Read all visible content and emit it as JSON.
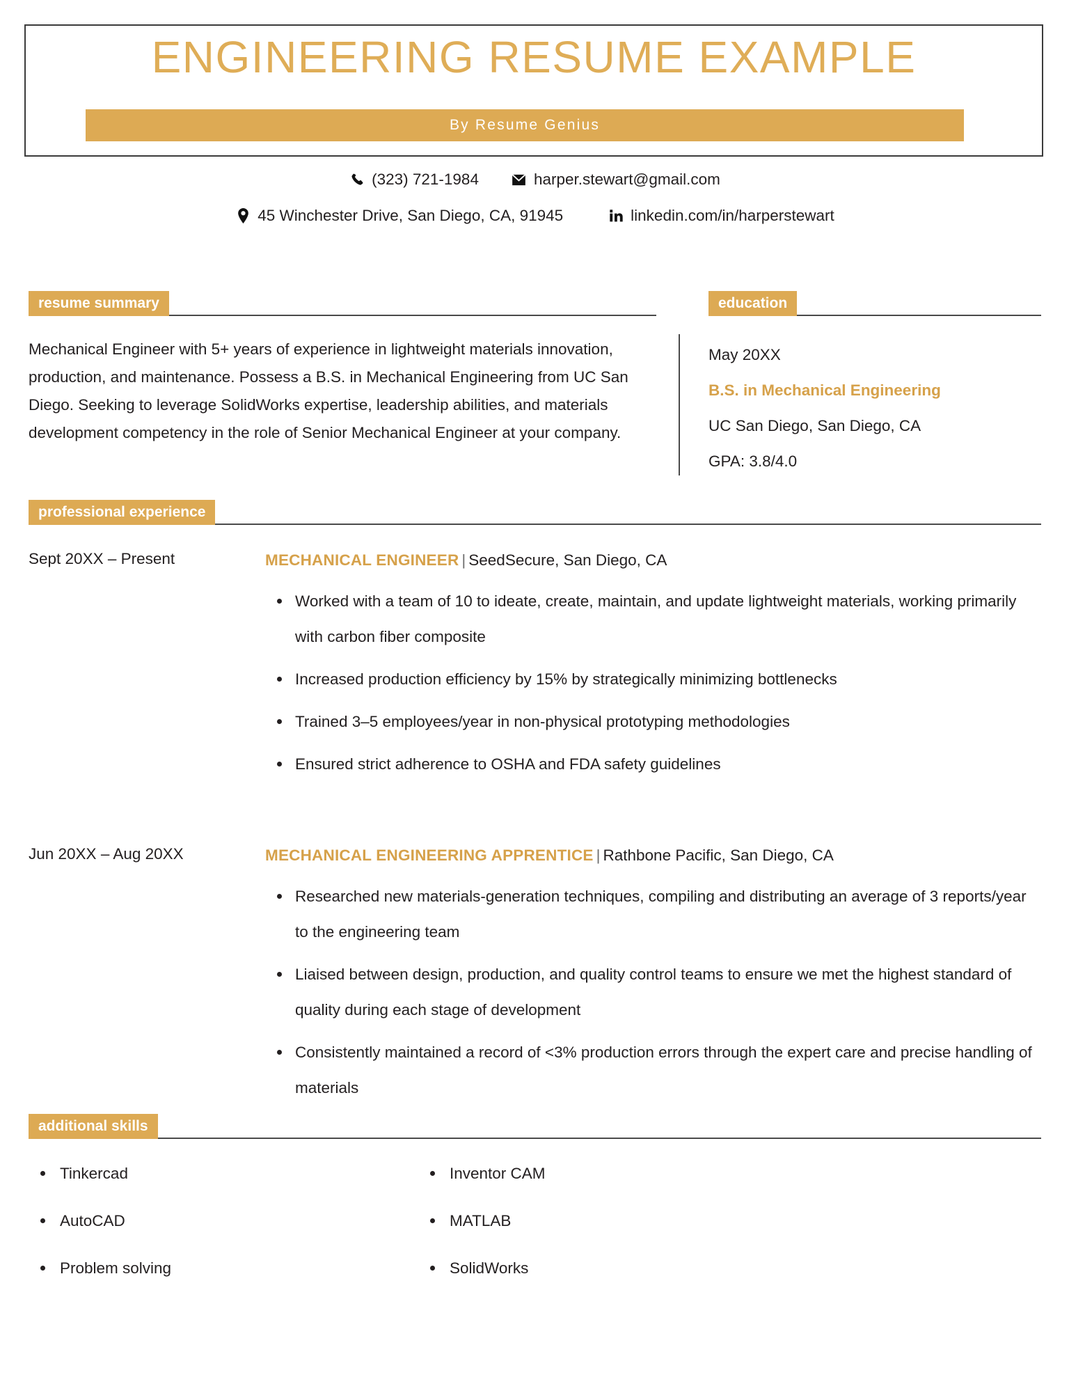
{
  "header": {
    "title": "ENGINEERING RESUME EXAMPLE",
    "byline": "By Resume Genius",
    "accent_color": "#ddaa54",
    "title_color": "#dfad57",
    "frame_color": "#3b3b3b"
  },
  "contact": {
    "phone": "(323) 721-1984",
    "email": "harper.stewart@gmail.com",
    "address": "45 Winchester Drive, San Diego, CA, 91945",
    "linkedin": "linkedin.com/in/harperstewart",
    "phone_icon": "phone-icon",
    "email_icon": "envelope-icon",
    "address_icon": "map-pin-icon",
    "linkedin_icon": "linkedin-icon"
  },
  "sections": {
    "summary_heading": "resume summary",
    "education_heading": "education",
    "experience_heading": "professional experience",
    "skills_heading": "additional skills"
  },
  "summary": {
    "text": "Mechanical Engineer with 5+ years of experience in lightweight materials innovation, production, and maintenance. Possess a B.S. in Mechanical Engineering from UC San Diego. Seeking to leverage SolidWorks expertise, leadership abilities, and materials development competency in the role of Senior Mechanical Engineer at your company."
  },
  "education": {
    "date": "May 20XX",
    "degree": "B.S. in Mechanical Engineering",
    "school": "UC San Diego, San Diego, CA",
    "gpa": "GPA: 3.8/4.0"
  },
  "experience": [
    {
      "date": "Sept 20XX – Present",
      "role": "MECHANICAL ENGINEER",
      "separator": "|",
      "company": "SeedSecure, San Diego, CA",
      "bullets": [
        "Worked with a team of 10 to ideate, create, maintain, and update lightweight materials, working primarily with carbon fiber composite",
        "Increased production efficiency by 15% by strategically minimizing bottlenecks",
        "Trained 3–5 employees/year in non-physical prototyping methodologies",
        "Ensured strict adherence to OSHA and FDA safety guidelines"
      ]
    },
    {
      "date": "Jun 20XX – Aug 20XX",
      "role": "MECHANICAL ENGINEERING APPRENTICE",
      "separator": "|",
      "company": "Rathbone Pacific, San Diego, CA",
      "bullets": [
        "Researched new materials-generation techniques, compiling and distributing an average of 3 reports/year to the engineering team",
        "Liaised between design, production, and quality control teams to ensure we met the highest standard of quality during each stage of development",
        "Consistently maintained a record of <3% production errors through the expert care and precise handling of materials"
      ]
    }
  ],
  "skills": {
    "left": [
      "Tinkercad",
      "AutoCAD",
      "Problem solving"
    ],
    "right": [
      "Inventor CAM",
      "MATLAB",
      "SolidWorks"
    ]
  }
}
